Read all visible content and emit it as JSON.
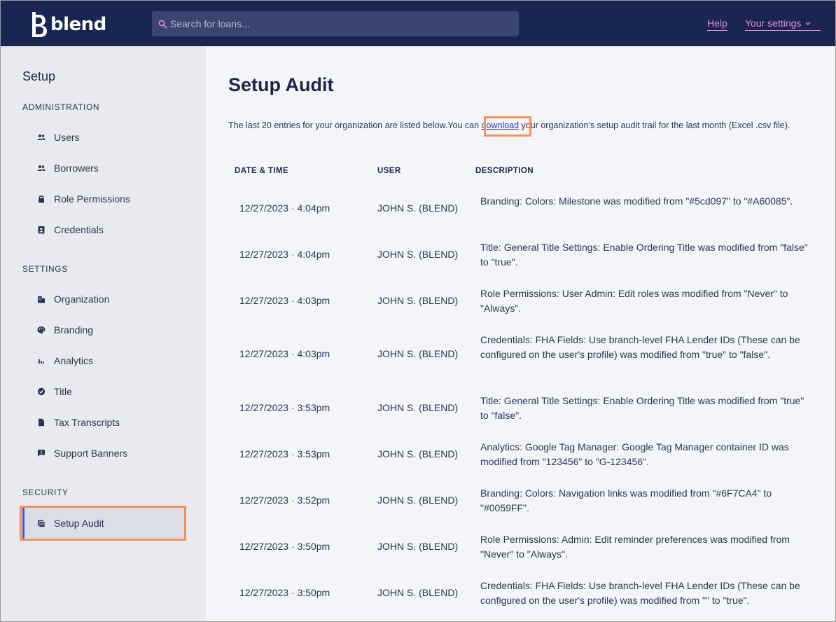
{
  "brand": {
    "name": "blend"
  },
  "search": {
    "placeholder": "Search for loans..."
  },
  "header": {
    "help": "Help",
    "settings": "Your settings"
  },
  "sidebar": {
    "title": "Setup",
    "sections": {
      "administration": "ADMINISTRATION",
      "settings": "SETTINGS",
      "security": "SECURITY"
    },
    "items": {
      "users": "Users",
      "borrowers": "Borrowers",
      "role_permissions": "Role Permissions",
      "credentials": "Credentials",
      "organization": "Organization",
      "branding": "Branding",
      "analytics": "Analytics",
      "title": "Title",
      "tax_transcripts": "Tax Transcripts",
      "support_banners": "Support Banners",
      "setup_audit": "Setup Audit"
    }
  },
  "main": {
    "title": "Setup Audit",
    "intro_before": "The last 20 entries for your organization are listed below.You can ",
    "intro_link": "download",
    "intro_after": " your organization's setup audit trail for the last month (Excel .csv file).",
    "columns": {
      "date": "DATE & TIME",
      "user": "USER",
      "description": "DESCRIPTION"
    },
    "rows": [
      {
        "date": "12/27/2023 · 4:04pm",
        "user": "JOHN S. (BLEND)",
        "description": "Branding: Colors: Milestone was modified from \"#5cd097\" to \"#A60085\"."
      },
      {
        "date": "12/27/2023 · 4:04pm",
        "user": "JOHN S. (BLEND)",
        "description": "Title: General Title Settings: Enable Ordering Title was modified from \"false\" to \"true\"."
      },
      {
        "date": "12/27/2023 · 4:03pm",
        "user": "JOHN S. (BLEND)",
        "description": "Role Permissions: User Admin: Edit roles was modified from \"Never\" to \"Always\"."
      },
      {
        "date": "12/27/2023 · 4:03pm",
        "user": "JOHN S. (BLEND)",
        "description": "Credentials: FHA Fields: Use branch-level FHA Lender IDs (These can be configured on the user's profile) was modified from \"true\" to \"false\"."
      },
      {
        "date": "12/27/2023 · 3:53pm",
        "user": "JOHN S. (BLEND)",
        "description": "Title: General Title Settings: Enable Ordering Title was modified from \"true\" to \"false\"."
      },
      {
        "date": "12/27/2023 · 3:53pm",
        "user": "JOHN S. (BLEND)",
        "description": "Analytics: Google Tag Manager: Google Tag Manager container ID was modified from \"123456\" to \"G-123456\"."
      },
      {
        "date": "12/27/2023 · 3:52pm",
        "user": "JOHN S. (BLEND)",
        "description": "Branding: Colors: Navigation links was modified from \"#6F7CA4\" to \"#0059FF\"."
      },
      {
        "date": "12/27/2023 · 3:50pm",
        "user": "JOHN S. (BLEND)",
        "description": "Role Permissions: Admin: Edit reminder preferences was modified from \"Never\" to \"Always\"."
      },
      {
        "date": "12/27/2023 · 3:50pm",
        "user": "JOHN S. (BLEND)",
        "description": "Credentials: FHA Fields: Use branch-level FHA Lender IDs (These can be configured on the user's profile) was modified from \"\" to \"true\"."
      }
    ]
  },
  "colors": {
    "topbar": "#192651",
    "accent_link": "#e58ae0",
    "highlight": "#f2925a",
    "active_bar": "#4a57d0"
  },
  "icons": {
    "search": "search-icon",
    "users": "people-icon",
    "borrowers": "people-icon",
    "role_permissions": "lock-icon",
    "credentials": "id-badge-icon",
    "organization": "building-icon",
    "branding": "palette-icon",
    "analytics": "bar-chart-icon",
    "title": "verified-badge-icon",
    "tax_transcripts": "document-icon",
    "support_banners": "message-alert-icon",
    "setup_audit": "audit-log-icon"
  }
}
